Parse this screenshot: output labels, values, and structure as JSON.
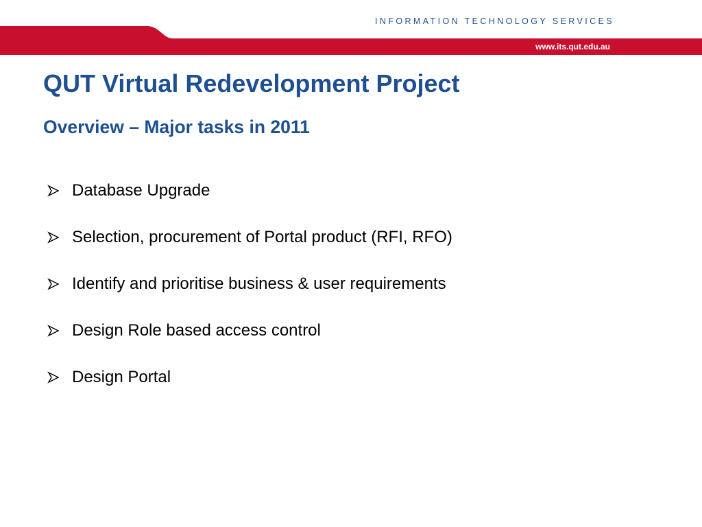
{
  "header": {
    "department": "INFORMATION TECHNOLOGY SERVICES",
    "url": "www.its.qut.edu.au"
  },
  "colors": {
    "banner_red": "#c8102e",
    "heading_blue": "#1d4f91",
    "body_text": "#000000"
  },
  "slide": {
    "title": "QUT Virtual Redevelopment Project",
    "subtitle": "Overview – Major tasks in 2011",
    "bullet_icon": "arrow-bullet-icon",
    "bullets": [
      "Database Upgrade",
      "Selection, procurement of Portal product (RFI, RFO)",
      "Identify and prioritise business & user requirements",
      "Design Role based access control",
      "Design Portal"
    ]
  }
}
